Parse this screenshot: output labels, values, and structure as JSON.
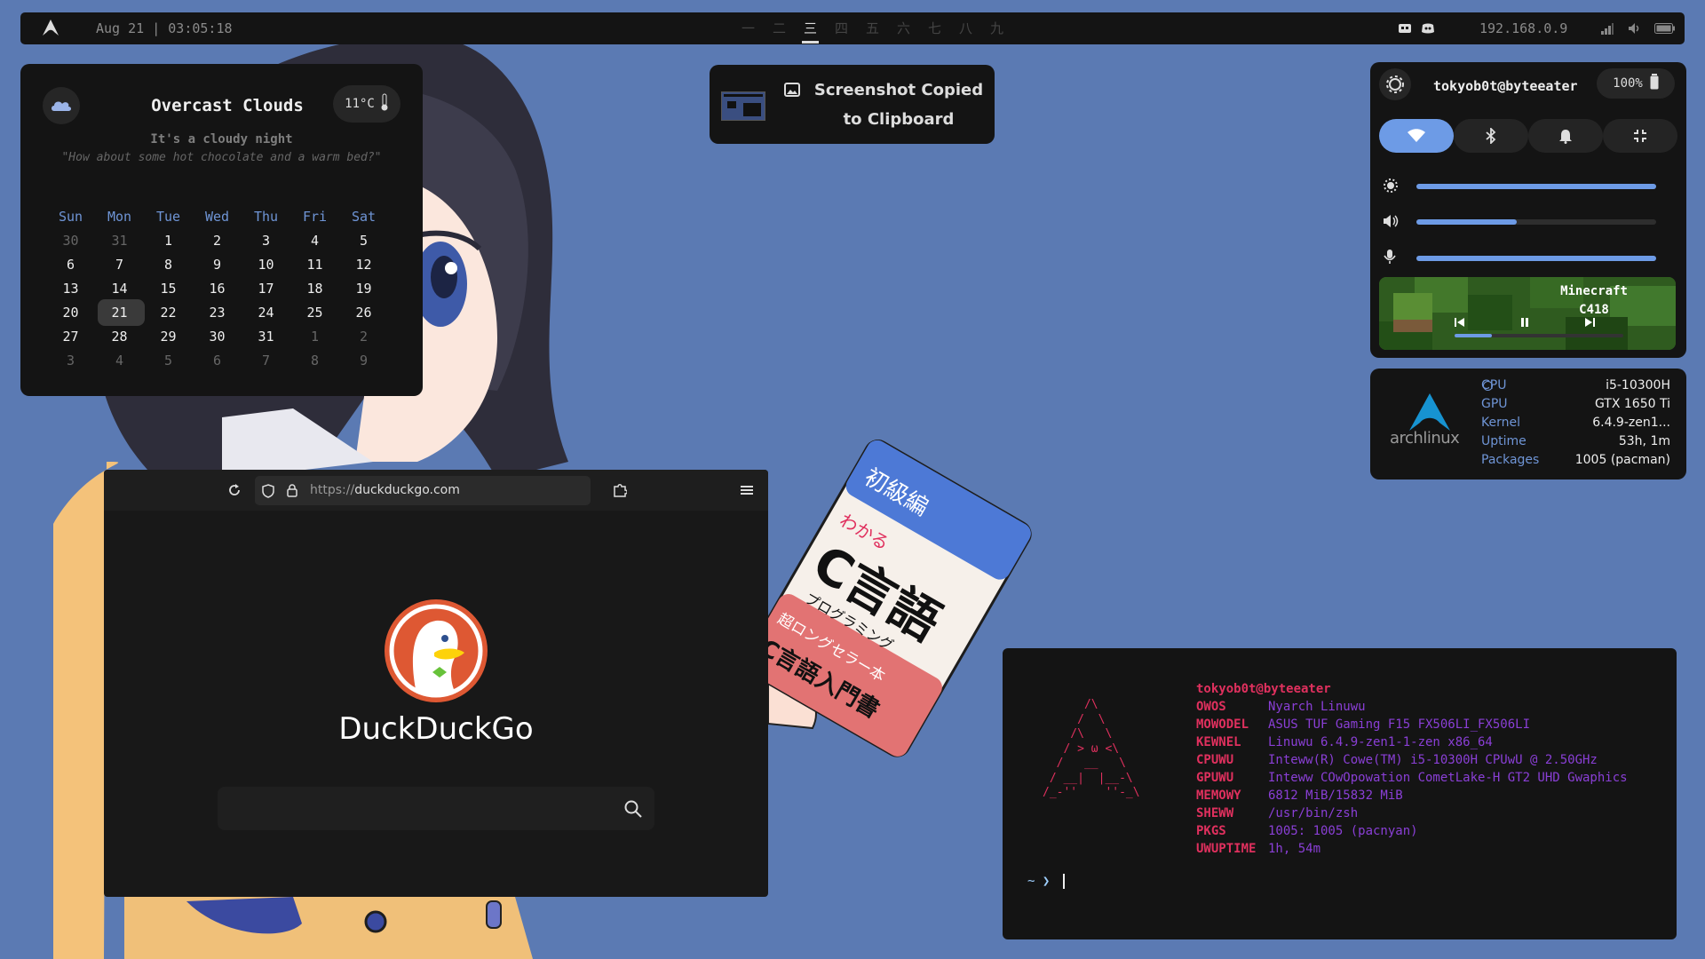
{
  "topbar": {
    "clock": "Aug 21 | 03:05:18",
    "workspaces": [
      "一",
      "二",
      "三",
      "四",
      "五",
      "六",
      "七",
      "八",
      "九"
    ],
    "active_workspace": 2,
    "ip": "192.168.0.9"
  },
  "weather": {
    "title": "Overcast Clouds",
    "temp": "11°C",
    "subtitle": "It's a cloudy night",
    "quote": "\"How about some hot chocolate and a warm bed?\""
  },
  "calendar": {
    "days": [
      "Sun",
      "Mon",
      "Tue",
      "Wed",
      "Thu",
      "Fri",
      "Sat"
    ],
    "weeks": [
      [
        "30",
        "31",
        "1",
        "2",
        "3",
        "4",
        "5"
      ],
      [
        "6",
        "7",
        "8",
        "9",
        "10",
        "11",
        "12"
      ],
      [
        "13",
        "14",
        "15",
        "16",
        "17",
        "18",
        "19"
      ],
      [
        "20",
        "21",
        "22",
        "23",
        "24",
        "25",
        "26"
      ],
      [
        "27",
        "28",
        "29",
        "30",
        "31",
        "1",
        "2"
      ],
      [
        "3",
        "4",
        "5",
        "6",
        "7",
        "8",
        "9"
      ]
    ],
    "today": "21"
  },
  "toast": {
    "text": "Screenshot Copied to Clipboard"
  },
  "control_center": {
    "user": "tokyob0t@byteeater",
    "battery": "100%",
    "brightness_level": 1.0,
    "volume_level": 0.42,
    "mic_level": 1.0,
    "media": {
      "title": "Minecraft",
      "artist": "C418",
      "progress": 0.22
    }
  },
  "sysinfo": {
    "logo_text": "archlinux",
    "rows": [
      {
        "key": "CPU",
        "value": "i5-10300H"
      },
      {
        "key": "GPU",
        "value": "GTX 1650 Ti"
      },
      {
        "key": "Kernel",
        "value": "6.4.9-zen1..."
      },
      {
        "key": "Uptime",
        "value": "53h, 1m"
      },
      {
        "key": "Packages",
        "value": "1005 (pacman)"
      }
    ]
  },
  "browser": {
    "url_prefix": "https://",
    "url_domain": "duckduckgo.com",
    "brand": "DuckDuckGo"
  },
  "terminal": {
    "ascii": "      /\\\n     /  \\\n    /\\   \\\n   / > ω <\\\n  /   __   \\\n / __|  |__-\\\n/_-''    ''-_\\",
    "header": "tokyob0t@byteeater",
    "rows": [
      {
        "key": "OWOS",
        "value": "Nyarch Linuwu"
      },
      {
        "key": "MOWODEL",
        "value": "ASUS TUF Gaming F15 FX506LI_FX506LI"
      },
      {
        "key": "KEWNEL",
        "value": "Linuwu 6.4.9-zen1-1-zen x86_64"
      },
      {
        "key": "CPUWU",
        "value": "Inteww(R) Cowe(TM) i5-10300H CPUwU @ 2.50GHz"
      },
      {
        "key": "GPUWU",
        "value": "Inteww COwOpowation CometLake-H GT2 UHD Gwaphics"
      },
      {
        "key": "MEMOWY",
        "value": "6812 MiB/15832 MiB"
      },
      {
        "key": "SHEWW",
        "value": "/usr/bin/zsh"
      },
      {
        "key": "PKGS",
        "value": "1005: 1005 (pacnyan)"
      },
      {
        "key": "UWUPTIME",
        "value": "1h, 54m"
      }
    ],
    "prompt": "~ ❯"
  },
  "wallpaper": {
    "book_lines": [
      "わかる",
      "C言語",
      "超ロングセラー本",
      "C言語入門書",
      "プログラミング",
      "初級編"
    ]
  }
}
